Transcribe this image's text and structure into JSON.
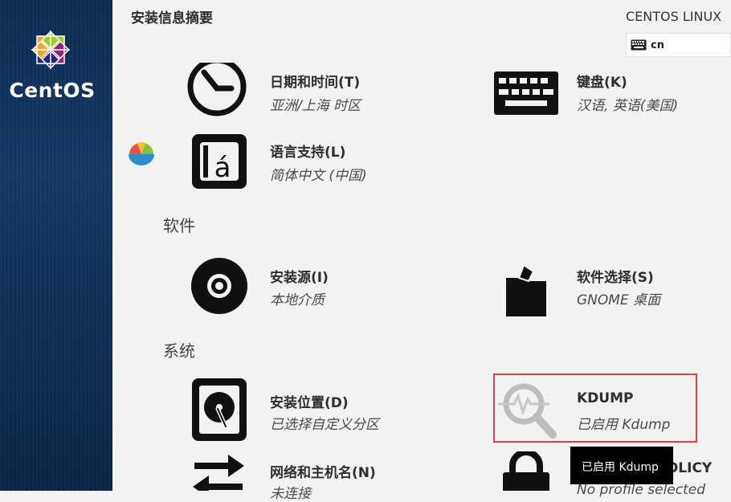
{
  "sidebar": {
    "brand": "CentOS"
  },
  "header": {
    "title": "安装信息摘要",
    "product": "CENTOS LINUX",
    "keyboard_layout": "cn"
  },
  "sections": {
    "software": "软件",
    "system": "系统"
  },
  "spokes": {
    "datetime": {
      "title": "日期和时间(T)",
      "status": "亚洲/上海 时区",
      "icon": "clock-icon"
    },
    "keyboard": {
      "title": "键盘(K)",
      "status": "汉语, 英语(美国)",
      "icon": "keyboard-icon"
    },
    "language": {
      "title": "语言支持(L)",
      "status": "简体中文 (中国)",
      "icon": "language-icon"
    },
    "source": {
      "title": "安装源(I)",
      "status": "本地介质",
      "icon": "disc-icon"
    },
    "software_selection": {
      "title": "软件选择(S)",
      "status": "GNOME 桌面",
      "icon": "package-icon"
    },
    "install_dest": {
      "title": "安装位置(D)",
      "status": "已选择自定义分区",
      "icon": "harddisk-icon"
    },
    "kdump": {
      "title": "KDUMP",
      "status": "已启用 Kdump",
      "icon": "kdump-search-icon"
    },
    "network": {
      "title": "网络和主机名(N)",
      "status": "未连接",
      "icon": "network-arrows-icon"
    },
    "security": {
      "title": "SECURITY POLICY",
      "status": "No profile selected",
      "icon": "lock-icon"
    }
  },
  "tooltip": "已启用 Kdump",
  "colors": {
    "selection_border": "#e0404a",
    "sidebar": "#143a68"
  }
}
